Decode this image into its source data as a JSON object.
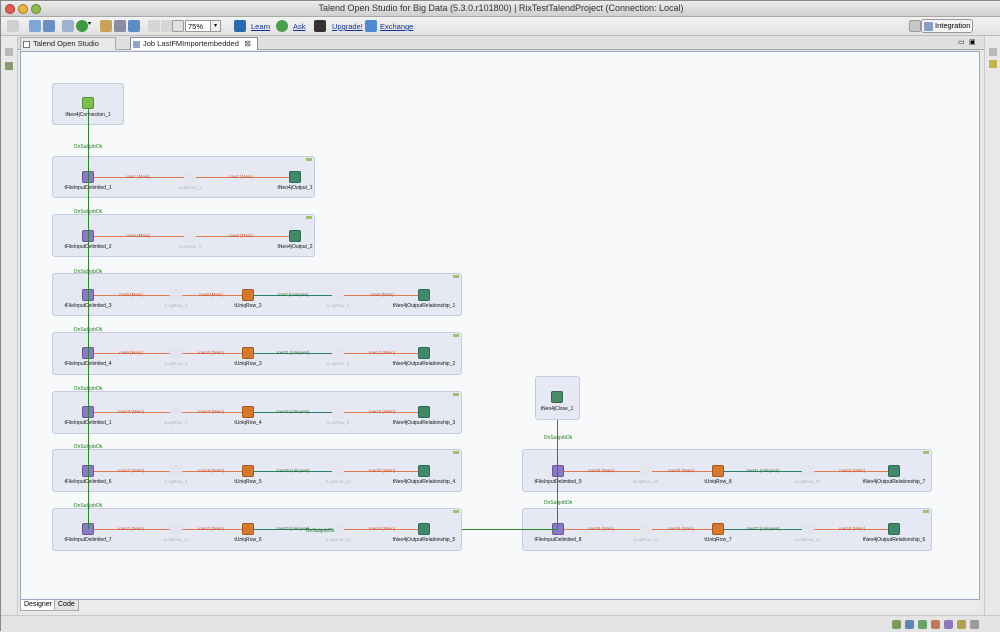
{
  "window": {
    "title": "Talend Open Studio for Big Data (5.3.0.r101800) | RixTestTalendProject (Connection: Local)"
  },
  "toolbar": {
    "zoom": "75%",
    "links": [
      "Learn",
      "Ask",
      "Upgrade!",
      "Exchange"
    ],
    "perspective": "Integration",
    "icons": [
      "back-arrow-icon",
      "new-job-icon",
      "save-icon",
      "import-icon",
      "run-icon",
      "run-dropdown-icon",
      "edit-icon",
      "wrench-icon",
      "export-icon",
      "undo-icon",
      "redo-icon",
      "zoom-icon",
      "learn-icon",
      "ask-icon",
      "upgrade-icon",
      "exchange-icon"
    ]
  },
  "tabs": [
    {
      "label": "Talend Open Studio",
      "icon": "studio-icon"
    },
    {
      "label": "Job LastFMImportembedded",
      "icon": "job-icon",
      "close": "⊠"
    }
  ],
  "bottom_tabs": [
    "Designer",
    "Code"
  ],
  "colors": {
    "row": "#c8552c",
    "uniques": "#2a6f2a",
    "trigger": "#1f7a1f",
    "subjob_bg": "#e6e8f3",
    "faded": "#b5b8c4"
  },
  "canvas": {
    "connection_node": "tNeo4jConnection_1",
    "close_node": "tNeo4jClose_1",
    "trigger": "OnSubjobOk",
    "subjobs": [
      {
        "input": "tFileInputDelimited_1",
        "r1": "row1 (Main)",
        "faded": "tLogRow_1",
        "r2": "row2 (Main)",
        "output": "tNeo4jOutput_1"
      },
      {
        "input": "tFileInputDelimited_2",
        "r1": "row3 (Main)",
        "faded": "tLogRow_2",
        "r2": "row4 (Main)",
        "output": "tNeo4jOutput_2"
      },
      {
        "input": "tFileInputDelimited_3",
        "r1": "row5 (Main)",
        "faded": "tLogRow_3",
        "r2": "row6 (Main)",
        "uniq": "tUniqRow_2",
        "r3": "row7 (Uniques)",
        "faded2": "tLogRow_4",
        "r4": "row8 (Main)",
        "output": "tNeo4jOutputRelationship_1"
      },
      {
        "input": "tFileInputDelimited_4",
        "r1": "row9 (Main)",
        "faded": "tLogRow_5",
        "r2": "row10 (Main)",
        "uniq": "tUniqRow_3",
        "r3": "row11 (Uniques)",
        "faded2": "tLogRow_6",
        "r4": "row12 (Main)",
        "output": "tNeo4jOutputRelationship_2"
      },
      {
        "input": "tFileInputDelimited_1",
        "r1": "row13 (Main)",
        "faded": "tLogRow_7",
        "r2": "row14 (Main)",
        "uniq": "tUniqRow_4",
        "r3": "row15 (Uniques)",
        "faded2": "tLogRow_8",
        "r4": "row16 (Main)",
        "output": "tNeo4jOutputRelationship_3"
      },
      {
        "input": "tFileInputDelimited_6",
        "r1": "row17 (Main)",
        "faded": "tLogRow_9",
        "r2": "row18 (Main)",
        "uniq": "tUniqRow_5",
        "r3": "row19 (Uniques)",
        "faded2": "tLogRow_10",
        "r4": "row20 (Main)",
        "output": "tNeo4jOutputRelationship_4"
      },
      {
        "input": "tFileInputDelimited_7",
        "r1": "row21 (Main)",
        "faded": "tLogRow_11",
        "r2": "row22 (Main)",
        "uniq": "tUniqRow_6",
        "r3": "row23 (Uniques)",
        "faded2": "tLogRow_12",
        "r4": "row24 (Main)",
        "output": "tNeo4jOutputRelationship_5"
      },
      {
        "input": "tFileInputDelimited_9",
        "r1": "row29 (Main)",
        "faded": "tLogRow_15",
        "r2": "row30 (Main)",
        "uniq": "tUniqRow_8",
        "r3": "row31 (Uniques)",
        "faded2": "tLogRow_16",
        "r4": "row32 (Main)",
        "output": "tNeo4jOutputRelationship_7"
      },
      {
        "input": "tFileInputDelimited_8",
        "r1": "row25 (Main)",
        "faded": "tLogRow_13",
        "r2": "row26 (Main)",
        "uniq": "tUniqRow_7",
        "r3": "row27 (Uniques)",
        "faded2": "tLogRow_14",
        "r4": "row28 (Main)",
        "output": "tNeo4jOutputRelationship_6"
      }
    ]
  }
}
